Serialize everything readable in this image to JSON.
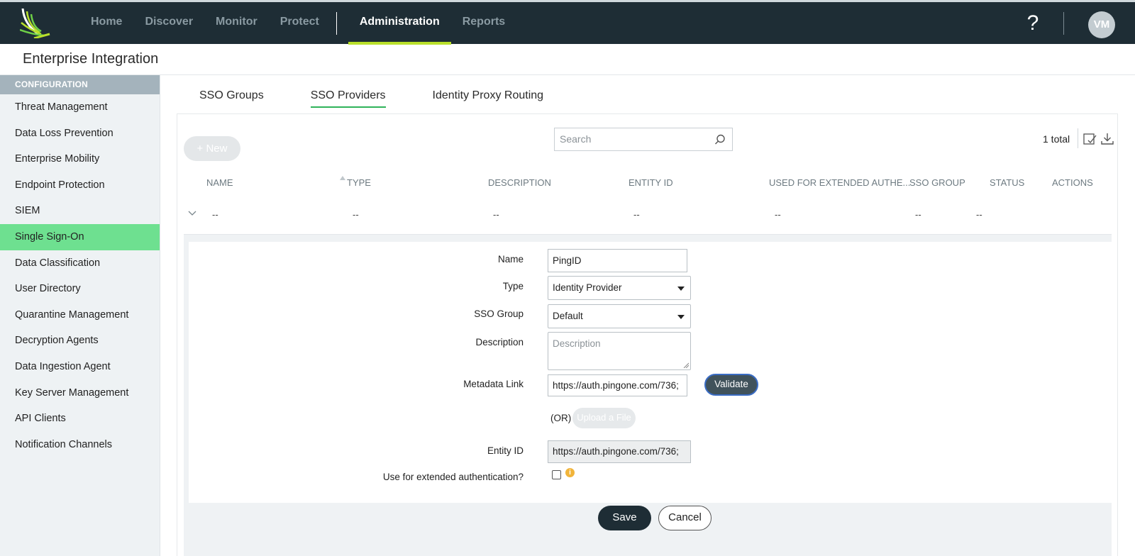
{
  "nav": {
    "items": [
      {
        "label": "Home",
        "active": false
      },
      {
        "label": "Discover",
        "active": false
      },
      {
        "label": "Monitor",
        "active": false
      },
      {
        "label": "Protect",
        "active": false
      },
      {
        "label": "Administration",
        "active": true
      },
      {
        "label": "Reports",
        "active": false
      }
    ],
    "help_label": "?",
    "avatar_initials": "VM"
  },
  "page": {
    "title": "Enterprise Integration"
  },
  "sidebar": {
    "heading": "CONFIGURATION",
    "items": [
      {
        "label": "Threat Management"
      },
      {
        "label": "Data Loss Prevention"
      },
      {
        "label": "Enterprise Mobility"
      },
      {
        "label": "Endpoint Protection"
      },
      {
        "label": "SIEM"
      },
      {
        "label": "Single Sign-On",
        "active": true
      },
      {
        "label": "Data Classification"
      },
      {
        "label": "User Directory"
      },
      {
        "label": "Quarantine Management"
      },
      {
        "label": "Decryption Agents"
      },
      {
        "label": "Data Ingestion Agent"
      },
      {
        "label": "Key Server Management"
      },
      {
        "label": "API Clients"
      },
      {
        "label": "Notification Channels"
      }
    ]
  },
  "tabs": [
    {
      "label": "SSO Groups"
    },
    {
      "label": "SSO Providers",
      "active": true
    },
    {
      "label": "Identity Proxy Routing"
    }
  ],
  "toolbar": {
    "new_label": "+ New",
    "search_placeholder": "Search",
    "total": "1 total"
  },
  "table": {
    "columns": [
      "NAME",
      "TYPE",
      "DESCRIPTION",
      "ENTITY ID",
      "USED FOR EXTENDED AUTHE...",
      "SSO GROUP",
      "STATUS",
      "ACTIONS"
    ],
    "row": [
      "--",
      "--",
      "--",
      "--",
      "--",
      "--",
      "--"
    ]
  },
  "form": {
    "name_label": "Name",
    "name_value": "PingID",
    "type_label": "Type",
    "type_value": "Identity Provider",
    "sso_group_label": "SSO Group",
    "sso_group_value": "Default",
    "description_label": "Description",
    "description_placeholder": "Description",
    "metadata_label": "Metadata Link",
    "metadata_value": "https://auth.pingone.com/736;",
    "validate_label": "Validate",
    "or_label": "(OR)",
    "upload_label": "Upload a File",
    "entity_label": "Entity ID",
    "entity_value": "https://auth.pingone.com/736;",
    "extended_label": "Use for extended authentication?",
    "extended_checked": false,
    "info_glyph": "i",
    "save_label": "Save",
    "cancel_label": "Cancel"
  },
  "colors": {
    "topbar": "#1e2d35",
    "nav_accent": "#b9e02b",
    "sidebar_active": "#6ee090",
    "tab_accent": "#2fb35a",
    "validate_border": "#3a6cc4",
    "info": "#f1b43a"
  },
  "icons": [
    "logo-icon",
    "help-icon",
    "search-icon",
    "columns-icon",
    "download-icon",
    "sort-icon",
    "chevron-down-icon",
    "info-icon"
  ]
}
